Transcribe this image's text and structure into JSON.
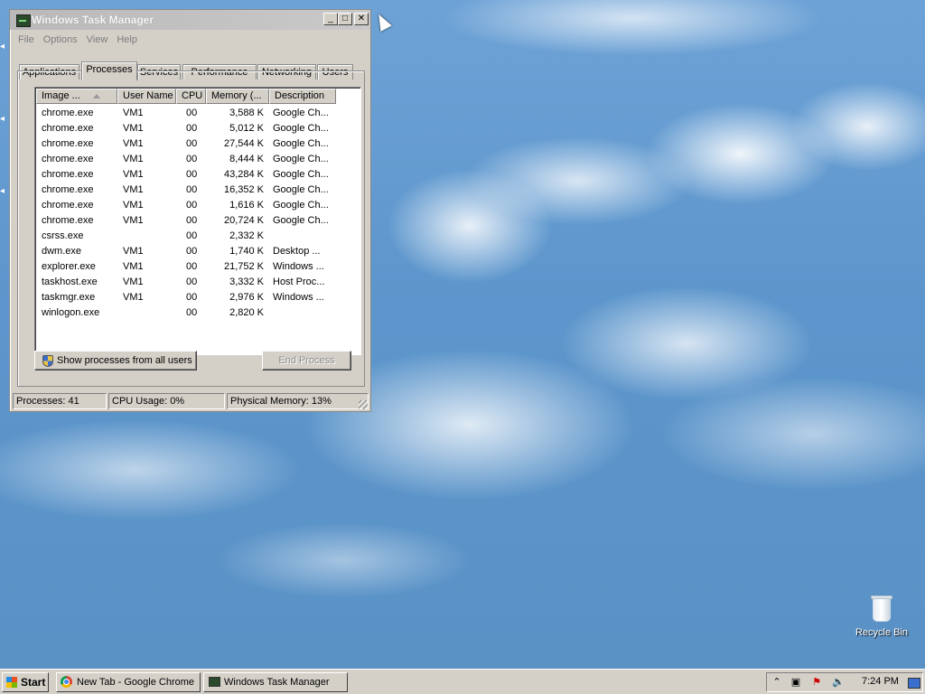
{
  "window": {
    "title": "Windows Task Manager",
    "controls": {
      "minimize": "_",
      "maximize": "□",
      "close": "✕"
    }
  },
  "menu": [
    "File",
    "Options",
    "View",
    "Help"
  ],
  "tabs": [
    "Applications",
    "Processes",
    "Services",
    "Performance",
    "Networking",
    "Users"
  ],
  "active_tab": "Processes",
  "columns": [
    "Image ...",
    "User Name",
    "CPU",
    "Memory (...",
    "Description"
  ],
  "processes": [
    {
      "image": "chrome.exe",
      "user": "VM1",
      "cpu": "00",
      "memory": "3,588 K",
      "description": "Google Ch..."
    },
    {
      "image": "chrome.exe",
      "user": "VM1",
      "cpu": "00",
      "memory": "5,012 K",
      "description": "Google Ch..."
    },
    {
      "image": "chrome.exe",
      "user": "VM1",
      "cpu": "00",
      "memory": "27,544 K",
      "description": "Google Ch..."
    },
    {
      "image": "chrome.exe",
      "user": "VM1",
      "cpu": "00",
      "memory": "8,444 K",
      "description": "Google Ch..."
    },
    {
      "image": "chrome.exe",
      "user": "VM1",
      "cpu": "00",
      "memory": "43,284 K",
      "description": "Google Ch..."
    },
    {
      "image": "chrome.exe",
      "user": "VM1",
      "cpu": "00",
      "memory": "16,352 K",
      "description": "Google Ch..."
    },
    {
      "image": "chrome.exe",
      "user": "VM1",
      "cpu": "00",
      "memory": "1,616 K",
      "description": "Google Ch..."
    },
    {
      "image": "chrome.exe",
      "user": "VM1",
      "cpu": "00",
      "memory": "20,724 K",
      "description": "Google Ch..."
    },
    {
      "image": "csrss.exe",
      "user": "",
      "cpu": "00",
      "memory": "2,332 K",
      "description": ""
    },
    {
      "image": "dwm.exe",
      "user": "VM1",
      "cpu": "00",
      "memory": "1,740 K",
      "description": "Desktop ..."
    },
    {
      "image": "explorer.exe",
      "user": "VM1",
      "cpu": "00",
      "memory": "21,752 K",
      "description": "Windows ..."
    },
    {
      "image": "taskhost.exe",
      "user": "VM1",
      "cpu": "00",
      "memory": "3,332 K",
      "description": "Host Proc..."
    },
    {
      "image": "taskmgr.exe",
      "user": "VM1",
      "cpu": "00",
      "memory": "2,976 K",
      "description": "Windows ..."
    },
    {
      "image": "winlogon.exe",
      "user": "",
      "cpu": "00",
      "memory": "2,820 K",
      "description": ""
    }
  ],
  "buttons": {
    "show_all": "Show processes from all users",
    "end_process": "End Process"
  },
  "status": {
    "processes": "Processes: 41",
    "cpu": "CPU Usage: 0%",
    "memory": "Physical Memory: 13%"
  },
  "desktop": {
    "recycle_bin": "Recycle Bin"
  },
  "taskbar": {
    "start": "Start",
    "tasks": [
      "New Tab - Google Chrome",
      "Windows Task Manager"
    ],
    "clock": "7:24 PM",
    "tray_icons": [
      "chevron-up-icon",
      "network-icon",
      "action-center-icon",
      "volume-icon"
    ]
  }
}
